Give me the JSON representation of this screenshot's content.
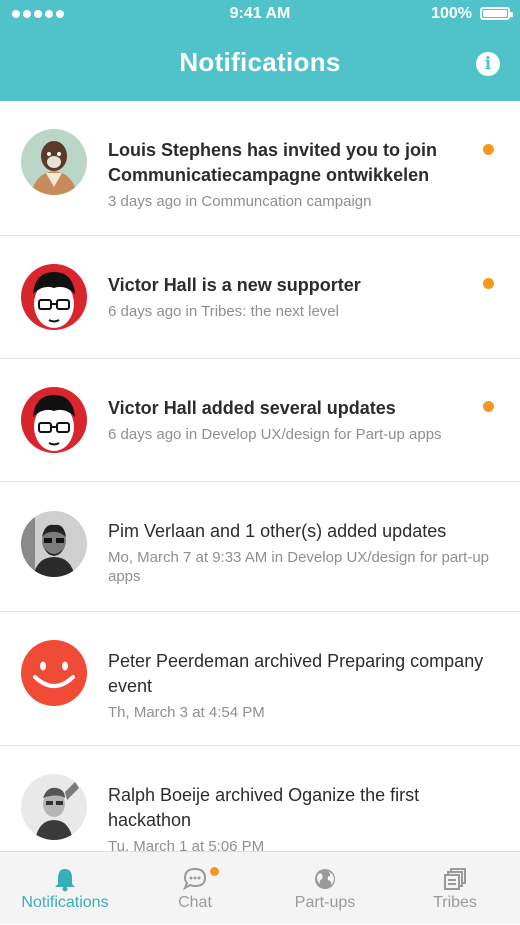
{
  "status_bar": {
    "time": "9:41 AM",
    "battery": "100%"
  },
  "header": {
    "title": "Notifications"
  },
  "notifications": [
    {
      "message": "Louis Stephens has invited you to join Communicatiecampagne ontwikkelen",
      "meta": "3 days ago in Communcation campaign",
      "unread": true
    },
    {
      "message": "Victor Hall is a new supporter",
      "meta": "6 days ago in Tribes: the next level",
      "unread": true
    },
    {
      "message": "Victor Hall added several updates",
      "meta": "6 days ago in Develop UX/design for Part-up apps",
      "unread": true
    },
    {
      "message": "Pim Verlaan and 1 other(s) added updates",
      "meta": "Mo, March 7 at 9:33 AM in Develop UX/design for part-up apps",
      "unread": false
    },
    {
      "message": "Peter Peerdeman archived Preparing company event",
      "meta": "Th, March 3 at 4:54 PM",
      "unread": false
    },
    {
      "message": "Ralph Boeije archived Oganize the first hackathon",
      "meta": "Tu, March 1 at 5:06 PM",
      "unread": false
    }
  ],
  "tabs": [
    {
      "label": "Notifications",
      "icon": "bell-icon",
      "active": true
    },
    {
      "label": "Chat",
      "icon": "chat-bubble-icon",
      "active": false,
      "badge": true
    },
    {
      "label": "Part-ups",
      "icon": "globe-icon",
      "active": false
    },
    {
      "label": "Tribes",
      "icon": "stacked-squares-icon",
      "active": false
    }
  ],
  "colors": {
    "header": "#4fc3c9",
    "accent": "#3aaeb6",
    "unread_dot": "#f39a1e"
  }
}
